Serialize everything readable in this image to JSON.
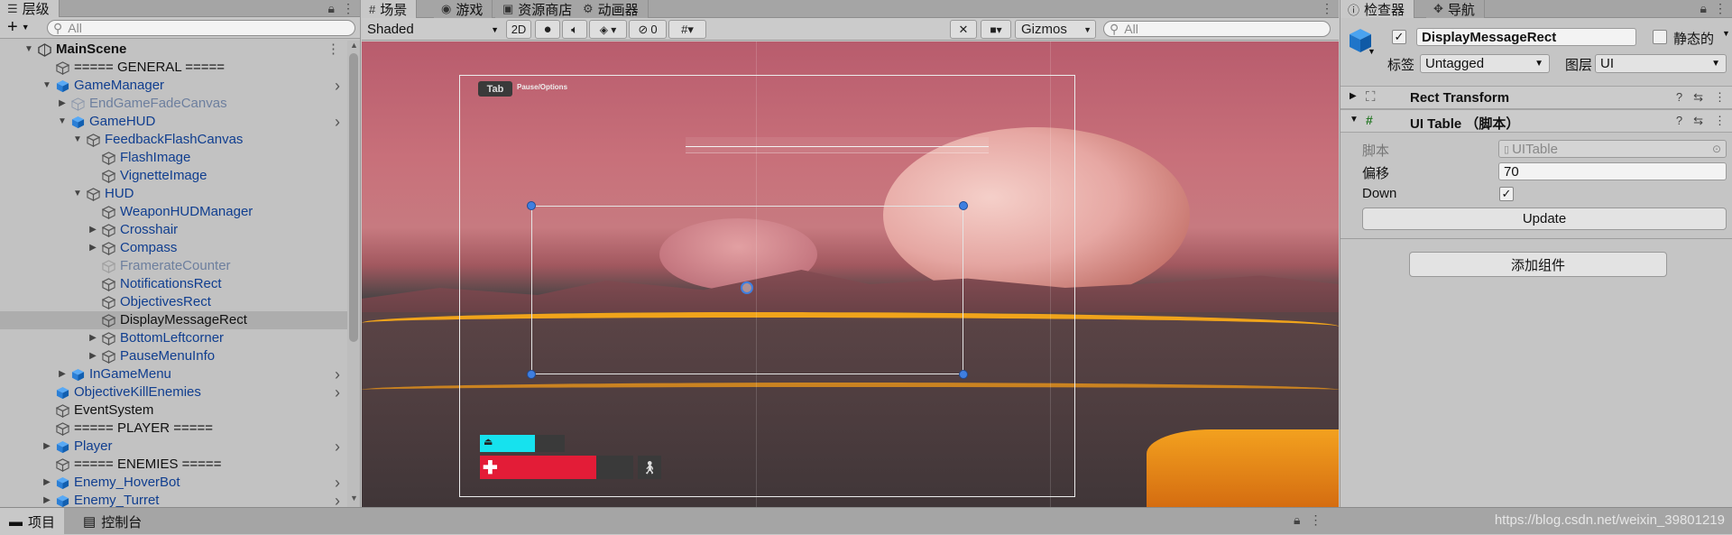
{
  "hierarchy": {
    "tab_label": "层级",
    "add_label": "+",
    "search_placeholder": "All",
    "items": [
      {
        "label": "MainScene",
        "depth": 0,
        "arrow": "down",
        "kind": "scene",
        "more": true
      },
      {
        "label": "===== GENERAL =====",
        "depth": 1,
        "arrow": "",
        "kind": "empty",
        "color": "black"
      },
      {
        "label": "GameManager",
        "depth": 1,
        "arrow": "down",
        "kind": "prefab",
        "color": "blue",
        "chevron": true
      },
      {
        "label": "EndGameFadeCanvas",
        "depth": 2,
        "arrow": "right",
        "kind": "prefab-dim",
        "color": "dim"
      },
      {
        "label": "GameHUD",
        "depth": 2,
        "arrow": "down",
        "kind": "prefab",
        "color": "blue",
        "chevron": true
      },
      {
        "label": "FeedbackFlashCanvas",
        "depth": 3,
        "arrow": "down",
        "kind": "obj",
        "color": "blue"
      },
      {
        "label": "FlashImage",
        "depth": 4,
        "arrow": "",
        "kind": "obj",
        "color": "blue"
      },
      {
        "label": "VignetteImage",
        "depth": 4,
        "arrow": "",
        "kind": "obj",
        "color": "blue"
      },
      {
        "label": "HUD",
        "depth": 3,
        "arrow": "down",
        "kind": "obj",
        "color": "blue"
      },
      {
        "label": "WeaponHUDManager",
        "depth": 4,
        "arrow": "",
        "kind": "obj",
        "color": "blue"
      },
      {
        "label": "Crosshair",
        "depth": 4,
        "arrow": "right",
        "kind": "obj",
        "color": "blue"
      },
      {
        "label": "Compass",
        "depth": 4,
        "arrow": "right",
        "kind": "obj",
        "color": "blue"
      },
      {
        "label": "FramerateCounter",
        "depth": 4,
        "arrow": "",
        "kind": "obj-dim",
        "color": "dim"
      },
      {
        "label": "NotificationsRect",
        "depth": 4,
        "arrow": "",
        "kind": "obj",
        "color": "blue"
      },
      {
        "label": "ObjectivesRect",
        "depth": 4,
        "arrow": "",
        "kind": "obj",
        "color": "blue"
      },
      {
        "label": "DisplayMessageRect",
        "depth": 4,
        "arrow": "",
        "kind": "obj",
        "color": "black",
        "selected": true
      },
      {
        "label": "BottomLeftcorner",
        "depth": 4,
        "arrow": "right",
        "kind": "obj",
        "color": "blue"
      },
      {
        "label": "PauseMenuInfo",
        "depth": 4,
        "arrow": "right",
        "kind": "obj",
        "color": "blue"
      },
      {
        "label": "InGameMenu",
        "depth": 2,
        "arrow": "right",
        "kind": "prefab",
        "color": "blue",
        "chevron": true
      },
      {
        "label": "ObjectiveKillEnemies",
        "depth": 1,
        "arrow": "",
        "kind": "prefab",
        "color": "blue",
        "chevron": true
      },
      {
        "label": "EventSystem",
        "depth": 1,
        "arrow": "",
        "kind": "empty",
        "color": "black"
      },
      {
        "label": "===== PLAYER =====",
        "depth": 1,
        "arrow": "",
        "kind": "empty",
        "color": "black"
      },
      {
        "label": "Player",
        "depth": 1,
        "arrow": "right",
        "kind": "prefab",
        "color": "blue",
        "chevron": true
      },
      {
        "label": "===== ENEMIES =====",
        "depth": 1,
        "arrow": "",
        "kind": "empty",
        "color": "black"
      },
      {
        "label": "Enemy_HoverBot",
        "depth": 1,
        "arrow": "right",
        "kind": "prefab",
        "color": "blue",
        "chevron": true
      },
      {
        "label": "Enemy_Turret",
        "depth": 1,
        "arrow": "right",
        "kind": "prefab",
        "color": "blue",
        "chevron": true
      }
    ]
  },
  "scene": {
    "tabs": [
      {
        "label": "场景",
        "icon": "grid-icon"
      },
      {
        "label": "游戏",
        "icon": "gamepad-icon"
      },
      {
        "label": "资源商店",
        "icon": "store-icon"
      },
      {
        "label": "动画器",
        "icon": "animator-icon"
      }
    ],
    "shading_mode": "Shaded",
    "mode_2d": "2D",
    "hidden_count": "0",
    "gizmos_label": "Gizmos",
    "search_placeholder": "All",
    "hud": {
      "tab_key": "Tab",
      "pause_hint": "Pause/Options",
      "stamina_fill": 0.65,
      "health_fill": 0.76
    }
  },
  "inspector": {
    "tabs": [
      {
        "label": "检查器",
        "icon": "info-icon"
      },
      {
        "label": "导航",
        "icon": "navigation-icon"
      }
    ],
    "object_name": "DisplayMessageRect",
    "active": true,
    "static_label": "静态的",
    "tag_label": "标签",
    "tag_value": "Untagged",
    "layer_label": "图层",
    "layer_value": "UI",
    "components": [
      {
        "name": "Rect Transform",
        "icon": "rect-transform-icon",
        "expanded": false
      },
      {
        "name": "UI Table （脚本）",
        "icon": "script-icon",
        "expanded": true
      }
    ],
    "script_label": "脚本",
    "script_value": "UITable",
    "offset_label": "偏移",
    "offset_value": "70",
    "down_label": "Down",
    "down_checked": true,
    "update_button": "Update",
    "add_component_button": "添加组件"
  },
  "bottom": {
    "tabs": [
      {
        "label": "项目",
        "icon": "folder-icon"
      },
      {
        "label": "控制台",
        "icon": "console-icon"
      }
    ],
    "watermark": "https://blog.csdn.net/weixin_39801219"
  }
}
